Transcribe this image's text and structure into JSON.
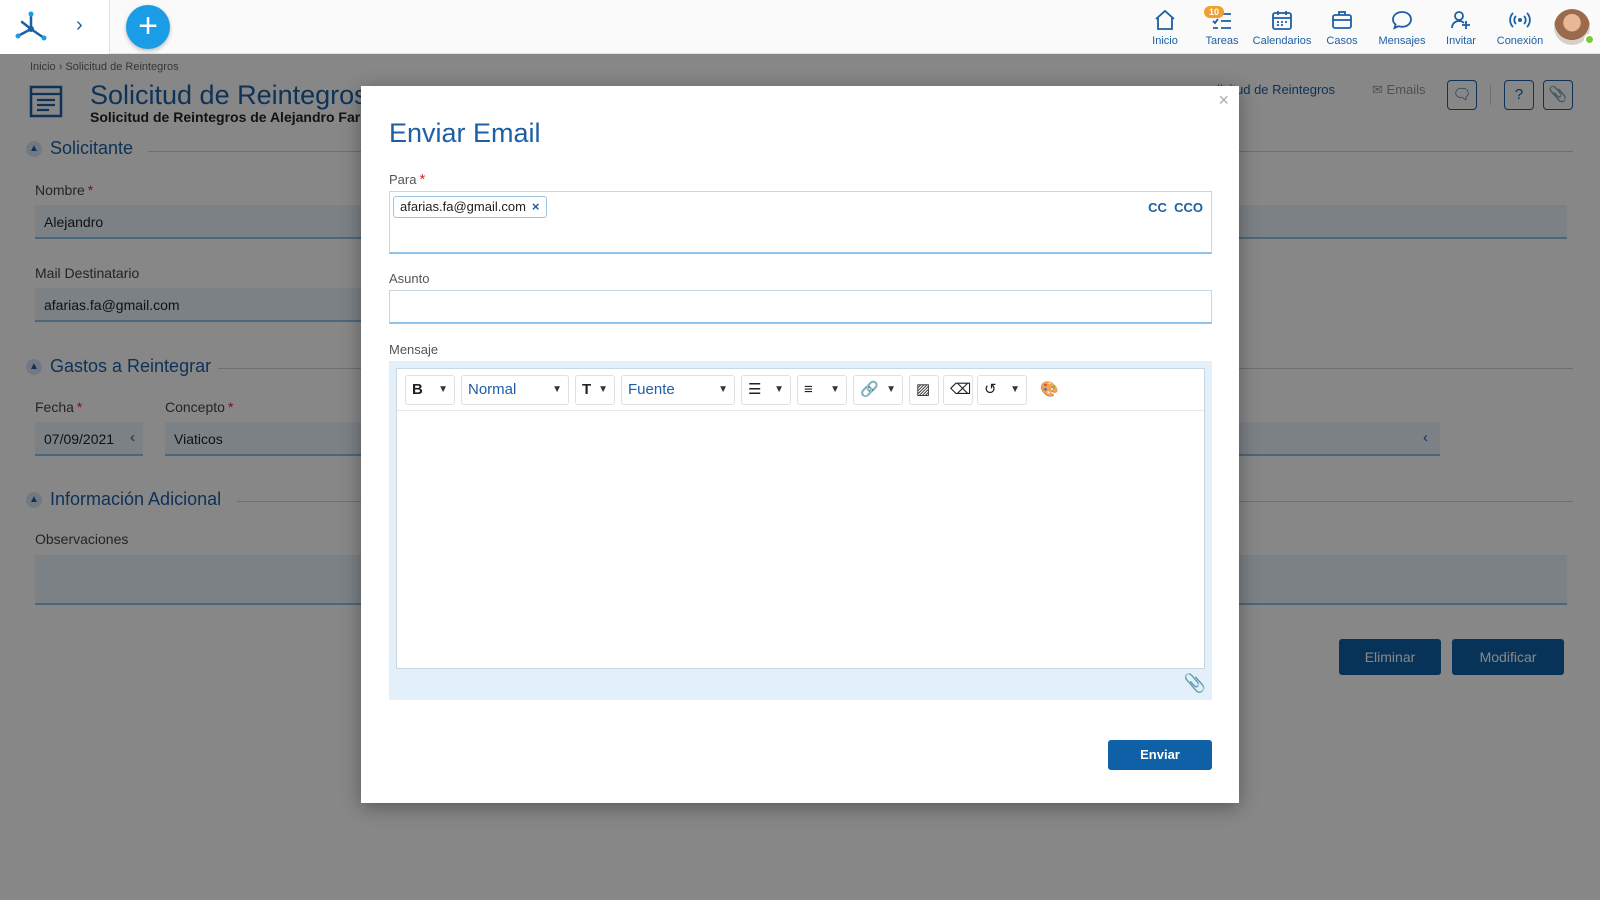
{
  "topbar": {
    "tasks_badge": "10",
    "nav": [
      {
        "label": "Inicio",
        "icon": "home-icon"
      },
      {
        "label": "Tareas",
        "icon": "tasks-icon"
      },
      {
        "label": "Calendarios",
        "icon": "calendar-icon"
      },
      {
        "label": "Casos",
        "icon": "briefcase-icon"
      },
      {
        "label": "Mensajes",
        "icon": "chat-icon"
      },
      {
        "label": "Invitar",
        "icon": "invite-icon"
      },
      {
        "label": "Conexión",
        "icon": "broadcast-icon"
      }
    ]
  },
  "page": {
    "breadcrumb": "Inicio › Solicitud de Reintegros",
    "title": "Solicitud de Reintegros",
    "subtitle": "Solicitud de Reintegros de Alejandro Farías",
    "right_link": "olicitud de Reintegros",
    "emails_link": "Emails",
    "sections": {
      "solicitante": "Solicitante",
      "gastos": "Gastos a Reintegrar",
      "info": "Información Adicional"
    },
    "fields": {
      "nombre_label": "Nombre",
      "nombre_value": "Alejandro",
      "mail_label": "Mail Destinatario",
      "mail_value": "afarias.fa@gmail.com",
      "fecha_label": "Fecha",
      "fecha_value": "07/09/2021",
      "concepto_label": "Concepto",
      "concepto_value": "Viaticos",
      "observaciones_label": "Observaciones"
    },
    "buttons": {
      "eliminar": "Eliminar",
      "modificar": "Modificar"
    }
  },
  "modal": {
    "close": "×",
    "title": "Enviar Email",
    "to_label": "Para",
    "recipient": "afarias.fa@gmail.com",
    "cc": "CC",
    "cco": "CCO",
    "subject_label": "Asunto",
    "subject_value": "",
    "message_label": "Mensaje",
    "toolbar": {
      "bold": "B",
      "paragraph_style": "Normal",
      "font": "Fuente"
    },
    "send": "Enviar"
  },
  "colors": {
    "primary": "#1d5fa5",
    "accent": "#1a9ce6",
    "button": "#1060a8"
  }
}
